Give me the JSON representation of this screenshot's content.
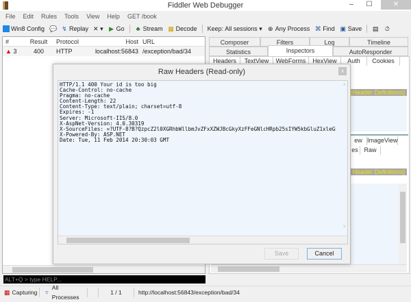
{
  "window": {
    "title": "Fiddler Web Debugger",
    "min": "–",
    "max": "☐",
    "close": "✕"
  },
  "menu": [
    "File",
    "Edit",
    "Rules",
    "Tools",
    "View",
    "Help",
    "GET /book"
  ],
  "toolbar": {
    "win8": "Win8 Config",
    "replay": "Replay",
    "remove": "✕ ▾",
    "go": "Go",
    "stream": "Stream",
    "decode": "Decode",
    "keep": "Keep: All sessions ▾",
    "process": "Any Process",
    "find": "Find",
    "save": "Save"
  },
  "sessions": {
    "headers": [
      "#",
      "Result",
      "Protocol",
      "Host",
      "URL"
    ],
    "rows": [
      {
        "num": "3",
        "result": "400",
        "protocol": "HTTP",
        "host": "localhost:56843",
        "url": "/exception/bad/34"
      }
    ]
  },
  "tabs": {
    "row1": [
      "Composer",
      "Filters",
      "Log",
      "Timeline"
    ],
    "row2": [
      "Statistics",
      "Inspectors",
      "AutoResponder"
    ],
    "request_subtabs": [
      "Headers",
      "TextView",
      "WebForms",
      "HexView",
      "Auth",
      "Cookies"
    ],
    "response_subtabs": [
      "ew",
      "ImageView"
    ],
    "response_subtabs2": [
      "es",
      "Raw"
    ],
    "header_def": "[Header Definitions]",
    "header_def2": "Header Definitions]",
    "bg_lines": [
      "Server: Microsoft-IIS/8.0",
      "X-AspNet-Version: 4.0.30319"
    ]
  },
  "dialog": {
    "title": "Raw Headers (Read-only)",
    "close": "x",
    "content": "HTTP/1.1 400 Your id is too big\nCache-Control: no-cache\nPragma: no-cache\nContent-Length: 22\nContent-Type: text/plain; charset=utf-8\nExpires: -1\nServer: Microsoft-IIS/8.0\nX-AspNet-Version: 4.0.30319\nX-SourceFiles: =?UTF-8?B?QzpcZ2l0XGRhbWllbmJvZFxXZWJBcGkyXzFFeGNlcHRpb25sIYW5kbGluZ1xleGNlcHRpb25cYmFkXDM0?=\nX-Powered-By: ASP.NET\nDate: Tue, 11 Feb 2014 20:30:03 GMT",
    "save": "Save",
    "cancel": "Cancel"
  },
  "quickexec": "ALT+Q > type HELP...",
  "status": {
    "capturing": "Capturing",
    "processes": "All Processes",
    "count": "1 / 1",
    "url": "http://localhost:56843/exception/bad/34"
  },
  "colors": {
    "error": "#e00000",
    "header_def_text": "#f3e400"
  }
}
